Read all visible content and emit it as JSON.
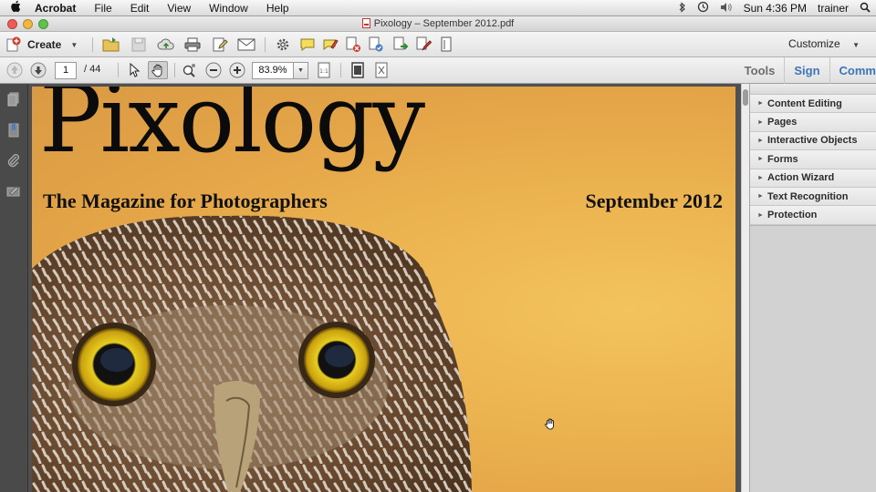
{
  "menubar": {
    "app_name": "Acrobat",
    "items": [
      "File",
      "Edit",
      "View",
      "Window",
      "Help"
    ],
    "clock": "Sun 4:36 PM",
    "user": "trainer"
  },
  "window": {
    "title": "Pixology – September 2012.pdf"
  },
  "toolbar": {
    "create_label": "Create",
    "customize_label": "Customize"
  },
  "navigation": {
    "current_page": "1",
    "page_total": "/ 44",
    "zoom": "83.9%"
  },
  "panel_tabs": {
    "tools": "Tools",
    "sign": "Sign",
    "comment": "Comm"
  },
  "tools_panel": {
    "sections": [
      "Content Editing",
      "Pages",
      "Interactive Objects",
      "Forms",
      "Action Wizard",
      "Text Recognition",
      "Protection"
    ]
  },
  "document": {
    "magazine_title": "Pixology",
    "magazine_subtitle": "The Magazine for Photographers",
    "issue_date": "September 2012"
  },
  "colors": {
    "accent_blue": "#3e74b8",
    "cover_orange": "#ecb451"
  }
}
